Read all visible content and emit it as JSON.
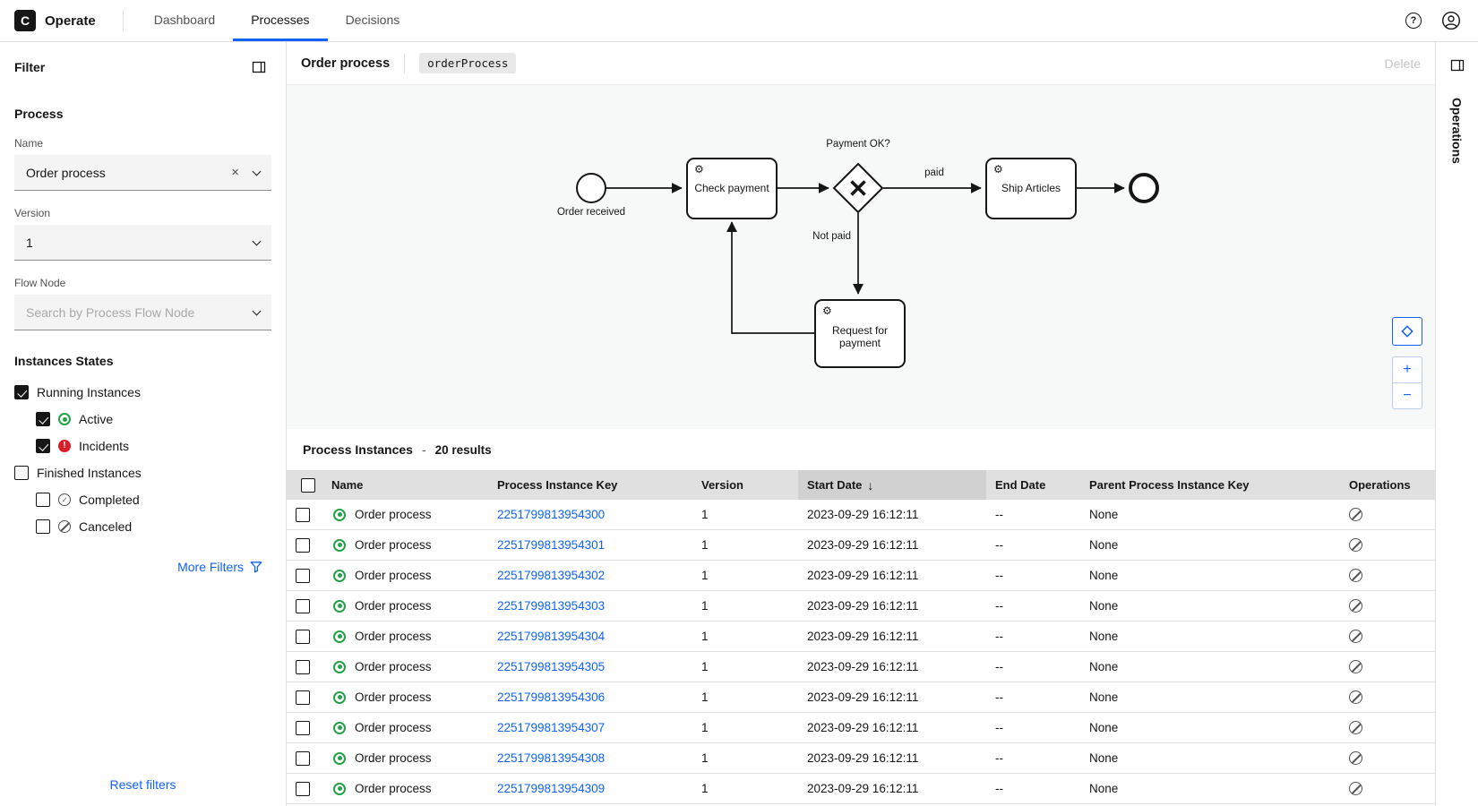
{
  "header": {
    "logo_letter": "C",
    "app_name": "Operate",
    "tabs": [
      {
        "label": "Dashboard"
      },
      {
        "label": "Processes"
      },
      {
        "label": "Decisions"
      }
    ]
  },
  "filter_panel": {
    "title": "Filter",
    "process_section_title": "Process",
    "name_label": "Name",
    "name_value": "Order process",
    "version_label": "Version",
    "version_value": "1",
    "flow_node_label": "Flow Node",
    "flow_node_placeholder": "Search by Process Flow Node",
    "states_title": "Instances States",
    "states": [
      {
        "label": "Running Instances",
        "checked": true,
        "icon": "none",
        "indent": false
      },
      {
        "label": "Active",
        "checked": true,
        "icon": "active",
        "indent": true
      },
      {
        "label": "Incidents",
        "checked": true,
        "icon": "incident",
        "indent": true
      },
      {
        "label": "Finished Instances",
        "checked": false,
        "icon": "none",
        "indent": false
      },
      {
        "label": "Completed",
        "checked": false,
        "icon": "completed",
        "indent": true
      },
      {
        "label": "Canceled",
        "checked": false,
        "icon": "canceled",
        "indent": true
      }
    ],
    "more_filters_label": "More Filters",
    "reset_filters_label": "Reset filters"
  },
  "main_header": {
    "title": "Order process",
    "process_id": "orderProcess",
    "delete_label": "Delete"
  },
  "diagram": {
    "start_event_label": "Order received",
    "task_check_payment": "Check payment",
    "gateway_label": "Payment OK?",
    "edge_paid_label": "paid",
    "edge_not_paid_label": "Not paid",
    "task_ship_articles": "Ship Articles",
    "task_request_line1": "Request for",
    "task_request_line2": "payment"
  },
  "instances": {
    "title": "Process Instances",
    "separator": "-",
    "results_label": "20 results",
    "columns": {
      "name": "Name",
      "key": "Process Instance Key",
      "version": "Version",
      "start": "Start Date",
      "end": "End Date",
      "parent": "Parent Process Instance Key",
      "operations": "Operations"
    },
    "rows": [
      {
        "name": "Order process",
        "key": "2251799813954300",
        "version": "1",
        "start": "2023-09-29 16:12:11",
        "end": "--",
        "parent": "None"
      },
      {
        "name": "Order process",
        "key": "2251799813954301",
        "version": "1",
        "start": "2023-09-29 16:12:11",
        "end": "--",
        "parent": "None"
      },
      {
        "name": "Order process",
        "key": "2251799813954302",
        "version": "1",
        "start": "2023-09-29 16:12:11",
        "end": "--",
        "parent": "None"
      },
      {
        "name": "Order process",
        "key": "2251799813954303",
        "version": "1",
        "start": "2023-09-29 16:12:11",
        "end": "--",
        "parent": "None"
      },
      {
        "name": "Order process",
        "key": "2251799813954304",
        "version": "1",
        "start": "2023-09-29 16:12:11",
        "end": "--",
        "parent": "None"
      },
      {
        "name": "Order process",
        "key": "2251799813954305",
        "version": "1",
        "start": "2023-09-29 16:12:11",
        "end": "--",
        "parent": "None"
      },
      {
        "name": "Order process",
        "key": "2251799813954306",
        "version": "1",
        "start": "2023-09-29 16:12:11",
        "end": "--",
        "parent": "None"
      },
      {
        "name": "Order process",
        "key": "2251799813954307",
        "version": "1",
        "start": "2023-09-29 16:12:11",
        "end": "--",
        "parent": "None"
      },
      {
        "name": "Order process",
        "key": "2251799813954308",
        "version": "1",
        "start": "2023-09-29 16:12:11",
        "end": "--",
        "parent": "None"
      },
      {
        "name": "Order process",
        "key": "2251799813954309",
        "version": "1",
        "start": "2023-09-29 16:12:11",
        "end": "--",
        "parent": "None"
      }
    ]
  },
  "operations_panel": {
    "title": "Operations"
  },
  "glyphs": {
    "help": "?",
    "clear": "×",
    "sort_desc": "↓",
    "zoom_in": "+",
    "zoom_out": "−",
    "gear": "⚙"
  },
  "colors": {
    "accent": "#0f62fe",
    "active_green": "#24a148",
    "incident_red": "#da1e28",
    "table_header": "#e0e0e0",
    "sorted_column": "#d1d1d1"
  }
}
